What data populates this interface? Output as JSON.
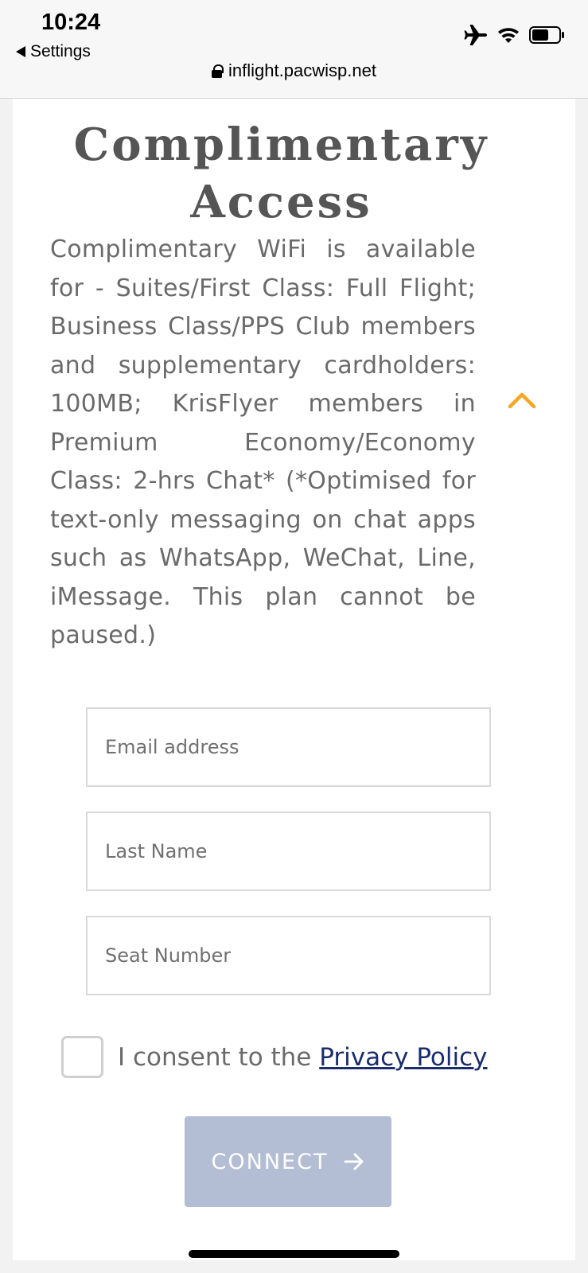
{
  "status_bar": {
    "time": "10:24",
    "back_label": "Settings",
    "url": "inflight.pacwisp.net",
    "icons": [
      "airplane-mode-icon",
      "wifi-icon",
      "battery-icon"
    ]
  },
  "card": {
    "title_line1": "Complimentary",
    "title_line2": "Access",
    "description": "Complimentary WiFi is available for - Suites/First Class: Full Flight; Business Class/PPS Club members and supplementary cardholders: 100MB; KrisFlyer members in Premium Economy/Economy Class: 2-hrs Chat* (*Optimised for text-only messaging on chat apps such as WhatsApp, WeChat, Line, iMessage. This plan cannot be paused.)",
    "collapse_icon": "chevron-up-icon",
    "accent_color": "#f5a623"
  },
  "form": {
    "email_placeholder": "Email address",
    "email_value": "",
    "last_name_placeholder": "Last Name",
    "last_name_value": "",
    "seat_placeholder": "Seat Number",
    "seat_value": "",
    "consent_text": "I consent to the",
    "consent_link": "Privacy Policy",
    "consent_checked": false,
    "connect_label": "CONNECT",
    "connect_icon": "arrow-right-icon",
    "connect_color": "#b3bdd4"
  }
}
